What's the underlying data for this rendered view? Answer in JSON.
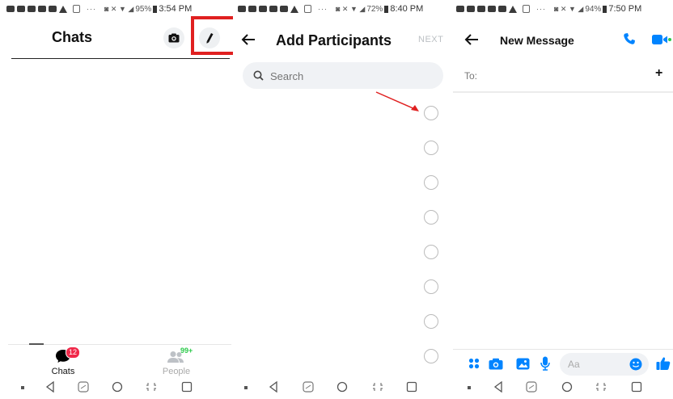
{
  "panel1": {
    "status": {
      "time": "3:54 PM",
      "battery": "95%"
    },
    "header": {
      "title": "Chats"
    },
    "bottom_tabs": [
      {
        "label": "Chats",
        "badge": "12"
      },
      {
        "label": "People",
        "badge": "99+"
      }
    ]
  },
  "panel2": {
    "status": {
      "time": "8:40 PM",
      "battery": "72%"
    },
    "header": {
      "title": "Add Participants",
      "next_label": "NEXT"
    },
    "search": {
      "placeholder": "Search"
    }
  },
  "panel3": {
    "status": {
      "time": "7:50 PM",
      "battery": "94%"
    },
    "header": {
      "title": "New Message"
    },
    "to_label": "To:",
    "composer": {
      "placeholder": "Aa"
    }
  },
  "colors": {
    "accent": "#0084ff",
    "highlight": "#e02020",
    "badge_red": "#f02849",
    "badge_green": "#2bc94a"
  },
  "icons": [
    "camera-icon",
    "pencil-icon",
    "back-arrow-icon",
    "search-icon",
    "phone-icon",
    "video-icon",
    "plus-icon",
    "apps-icon",
    "image-icon",
    "mic-icon",
    "emoji-icon",
    "like-icon"
  ]
}
